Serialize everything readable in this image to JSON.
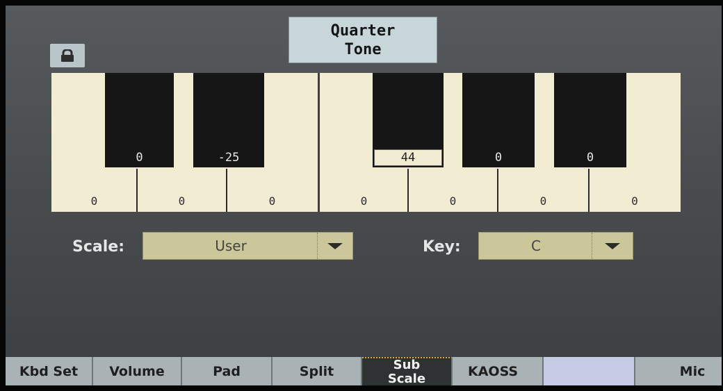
{
  "quarter_tone_button": {
    "line1": "Quarter",
    "line2": "Tone"
  },
  "icons": {
    "lock": "lock-icon",
    "dropdown": "chevron-down-icon"
  },
  "black_keys": [
    "0",
    "-25",
    "44",
    "0",
    "0"
  ],
  "white_keys": [
    "0",
    "0",
    "0",
    "0",
    "0",
    "0",
    "0"
  ],
  "selected_key": "44",
  "scale": {
    "label": "Scale:",
    "value": "User"
  },
  "key": {
    "label": "Key:",
    "value": "C"
  },
  "tabs": [
    "Kbd Set",
    "Volume",
    "Pad",
    "Split",
    "Sub Scale",
    "KAOSS",
    "",
    "Mic"
  ],
  "active_tab": {
    "line1": "Sub",
    "line2": "Scale"
  },
  "colors": {
    "accent": "#e2a33a",
    "dropdown": "#cbc79a",
    "tab": "#a9b3b6",
    "key_white": "#f1ecd2"
  }
}
